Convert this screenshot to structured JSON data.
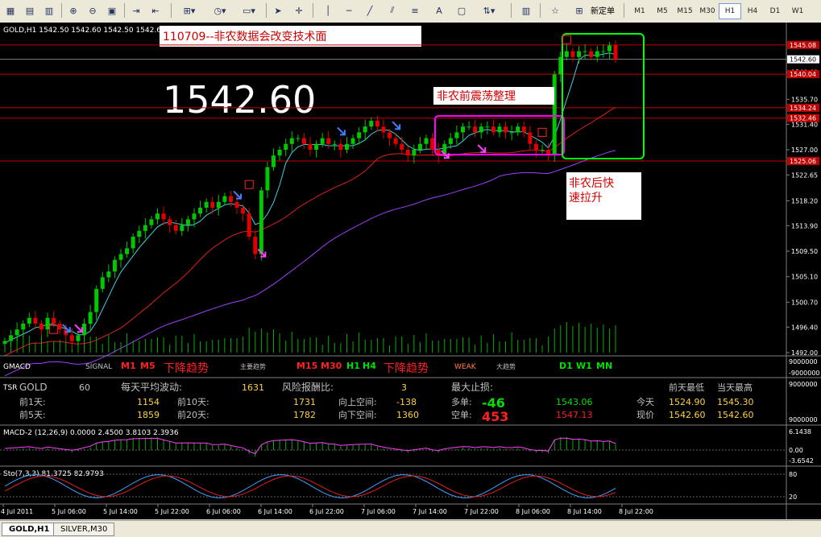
{
  "toolbar": {
    "new_order_label": "新定单",
    "timeframes": [
      "M1",
      "M5",
      "M15",
      "M30",
      "H1",
      "H4",
      "D1",
      "W1"
    ],
    "active_timeframe": "H1"
  },
  "chart": {
    "header": "GOLD,H1  1542.50 1542.60 1542.50 1542.60",
    "title_box": "110709--非农数据会改变技术面",
    "big_price": "1542.60",
    "consolidation_label": "非农前震荡整理",
    "rally_label_1": "非农后快",
    "rally_label_2": "速拉升",
    "price_ticks": [
      "1540.40",
      "1535.70",
      "1531.40",
      "1527.00",
      "1522.65",
      "1518.20",
      "1513.90",
      "1509.50",
      "1505.10",
      "1500.70",
      "1496.40",
      "1492.00"
    ],
    "price_tags": [
      "1545.08",
      "1542.60",
      "1540.04",
      "1534.24",
      "1532.46",
      "1525.06"
    ],
    "colors": {
      "up": "#00c800",
      "down": "#e00000",
      "ma_fast": "#40d0e0",
      "ma_mid": "#e02020",
      "ma_slow": "#a040ff",
      "box1": "#ff00ff",
      "box2": "#00ff00"
    },
    "chart_data": {
      "type": "candlestick",
      "instrument": "GOLD",
      "timeframe": "H1",
      "ylim": [
        1492.0,
        1547.0
      ],
      "x_ticks": [
        "4 Jul 2011",
        "5 Jul 06:00",
        "5 Jul 14:00",
        "5 Jul 22:00",
        "6 Jul 06:00",
        "6 Jul 14:00",
        "6 Jul 22:00",
        "7 Jul 06:00",
        "7 Jul 14:00",
        "7 Jul 22:00",
        "8 Jul 06:00",
        "8 Jul 14:00",
        "8 Jul 22:00"
      ],
      "close_series": [
        1494,
        1495,
        1496,
        1497,
        1498,
        1497,
        1496,
        1498,
        1497,
        1496,
        1495,
        1494,
        1495,
        1497,
        1499,
        1503,
        1505,
        1506,
        1508,
        1509,
        1510,
        1512,
        1513,
        1514,
        1515,
        1516,
        1515,
        1514,
        1513,
        1514,
        1515,
        1516,
        1517,
        1518,
        1517,
        1518,
        1519,
        1518,
        1517,
        1516,
        1512,
        1509,
        1520,
        1524,
        1526,
        1527,
        1528,
        1529,
        1529,
        1528,
        1527,
        1528,
        1529,
        1528,
        1528,
        1527,
        1528,
        1529,
        1530,
        1531,
        1532,
        1531,
        1530,
        1529,
        1528,
        1527,
        1526,
        1527,
        1528,
        1529,
        1527,
        1526,
        1528,
        1529,
        1530,
        1531,
        1531,
        1530,
        1531,
        1531,
        1530,
        1531,
        1530,
        1530,
        1531,
        1530,
        1528,
        1527,
        1527,
        1526,
        1540,
        1543,
        1544,
        1543,
        1544,
        1544,
        1543,
        1544,
        1544,
        1545,
        1542.6
      ]
    }
  },
  "gmacd": {
    "name": "GMACD",
    "signal": "SIGNAL",
    "m1": "M1",
    "m5": "M5",
    "trend_down": "下降趋势",
    "minor": "主要趋势",
    "m15": "M15",
    "m30": "M30",
    "h1": "H1",
    "h4": "H4",
    "trend_down2": "下降趋势",
    "weak": "WEAK",
    "big_trend": "大趋势",
    "d1": "D1",
    "w1": "W1",
    "mn": "MN",
    "scale_top": "9000000",
    "scale_bottom": "-9000000"
  },
  "tsr": {
    "name": "TSR",
    "symbol": "GOLD",
    "period": "60",
    "avg_label": "每天平均波动:",
    "avg_value": "1631",
    "risk_label": "风险报酬比:",
    "risk_value": "3",
    "stop_label": "最大止损:",
    "prev_low_label": "前天最低",
    "prev_high_label": "当天最高",
    "d1_label": "前1天:",
    "d1_val": "1154",
    "d10_label": "前10天:",
    "d10_val": "1731",
    "up_label": "向上空间:",
    "up_val": "-138",
    "long_label": "多单:",
    "long_val": "-46",
    "long_price": "1543.06",
    "today_label": "今天",
    "today_low": "1524.90",
    "today_high": "1545.30",
    "d5_label": "前5天:",
    "d5_val": "1859",
    "d20_label": "前20天:",
    "d20_val": "1782",
    "down_label": "向下空间:",
    "down_val": "1360",
    "short_label": "空单:",
    "short_val": "453",
    "short_price": "1547.13",
    "now_label": "现价",
    "now_low": "1542.60",
    "now_high": "1542.60",
    "scale_top": "9000000",
    "scale_bottom": "9000000"
  },
  "macd": {
    "header": "MACD-2 (12,26,9) 0.0000 2.4500 3.8103 2.3936",
    "t1": "6.1438",
    "t2": "0.00",
    "t3": "-3.6542"
  },
  "sto": {
    "header": "Sto(7,3,3) 81.3725 82.9793",
    "t1": "80",
    "t2": "20"
  },
  "status_tabs": [
    "GOLD,H1",
    "SILVER,M30"
  ]
}
